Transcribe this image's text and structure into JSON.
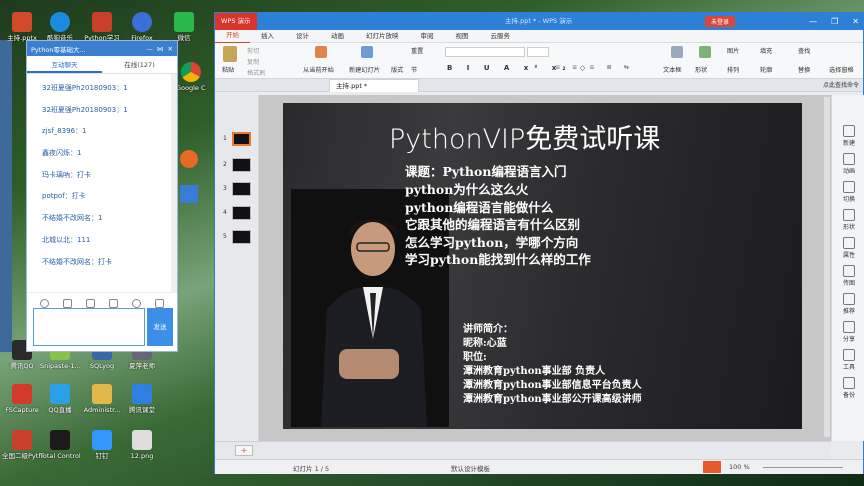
{
  "desktop": {
    "top_icons": [
      "主持.pptx",
      "酷狗音乐",
      "Python学习",
      "Firefox",
      "微信"
    ],
    "mid_icons": [
      "腾讯QQ",
      "Snipaste-1...",
      "SQLyog",
      "夏萍老师"
    ],
    "lower_icons": [
      "FSCapture",
      "QQ直播",
      "Administr...",
      "腾讯课堂"
    ],
    "bottom_icons": [
      "全国二级Python考...",
      "Total Control",
      "钉钉",
      "12.png"
    ],
    "side_icons": [
      "Google Chrome"
    ]
  },
  "chat": {
    "title": "Python零基础大...",
    "tab_interact": "互动聊天",
    "tab_online": "在线(127)",
    "messages": [
      "32班夏强Ph20180903：1",
      "32班夏强Ph20180903：1",
      "zjsf_8396：1",
      "鑫夜闪烁：1",
      "玛卡璃吶：打卡",
      "potpof：打卡",
      "不结婚不改网名：1",
      "北城以北：111",
      "不结婚不改网名：打卡"
    ],
    "send_label": "发送"
  },
  "wps": {
    "logo": "WPS 演示",
    "window_title": "主持.ppt * - WPS 演示",
    "login_label": "未登录",
    "menus": [
      "开始",
      "插入",
      "设计",
      "动画",
      "幻灯片放映",
      "审阅",
      "视图",
      "云服务"
    ],
    "ribbon": {
      "paste": "粘贴",
      "cut": "剪切",
      "copy": "复制",
      "format_painter": "格式刷",
      "from_current": "从当前开始",
      "new_slide": "新建幻灯片",
      "layout": "版式",
      "section": "节",
      "reset": "重置",
      "textbox": "文本框",
      "shapes": "形状",
      "arrange": "排列",
      "picture": "图片",
      "fill": "填充",
      "outline": "轮廓",
      "find": "查找",
      "replace": "替换",
      "select_pane": "选择窗格"
    },
    "doc_tab": "主持.ppt *",
    "search_placeholder": "点此查找命令",
    "thumb_numbers": [
      "1",
      "2",
      "3",
      "4",
      "5"
    ],
    "slide": {
      "title": "PythonVIP免费试听课",
      "topics": [
        "课题：Python编程语言入门",
        "python为什么这么火",
        "python编程语言能做什么",
        "它跟其他的编程语言有什么区别",
        "怎么学习python，学哪个方向",
        "学习python能找到什么样的工作"
      ],
      "intro": [
        "讲师简介：",
        "昵称:心蓝",
        "职位:",
        "潭洲教育python事业部 负责人",
        "潭洲教育python事业部信息平台负责人",
        "潭洲教育python事业部公开课高级讲师"
      ]
    },
    "right_panel": [
      "新建",
      "动画",
      "切换",
      "形状",
      "属性",
      "传图",
      "推荐",
      "分享",
      "工具",
      "备份"
    ],
    "status": {
      "slide_counter": "幻灯片 1 / 5",
      "design": "默认设计模板",
      "zoom": "100 %"
    }
  }
}
